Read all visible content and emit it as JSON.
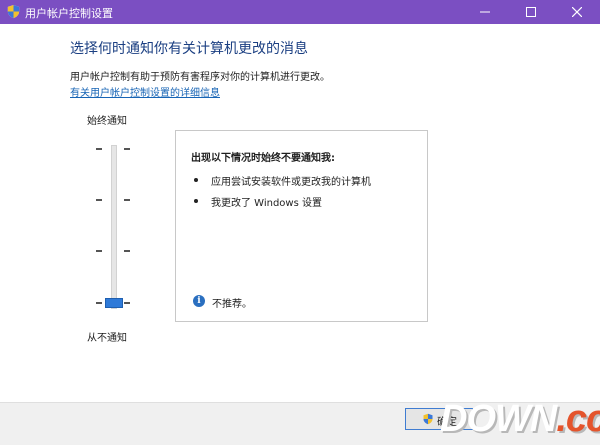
{
  "window": {
    "title": "用户帐户控制设置"
  },
  "main": {
    "heading": "选择何时通知你有关计算机更改的消息",
    "description": "用户帐户控制有助于预防有害程序对你的计算机进行更改。",
    "link": "有关用户帐户控制设置的详细信息"
  },
  "slider": {
    "top_label": "始终通知",
    "bottom_label": "从不通知",
    "levels": 4,
    "selected_level": 1
  },
  "info": {
    "heading": "出现以下情况时始终不要通知我:",
    "bullets": [
      "应用尝试安装软件或更改我的计算机",
      "我更改了 Windows 设置"
    ],
    "recommendation": "不推荐。"
  },
  "footer": {
    "ok_label": "确定"
  },
  "watermark": {
    "text_main": "DOWN",
    "text_dot": ".",
    "text_cc": "cc"
  },
  "colors": {
    "titlebar": "#7b4fc2",
    "heading": "#1b3f82",
    "link": "#1764b5",
    "slider_thumb": "#2f7ad8",
    "info_icon": "#2a6fc0"
  },
  "icons": {
    "title": "uac-shield-icon",
    "info": "info-icon",
    "ok_button": "uac-shield-icon"
  }
}
